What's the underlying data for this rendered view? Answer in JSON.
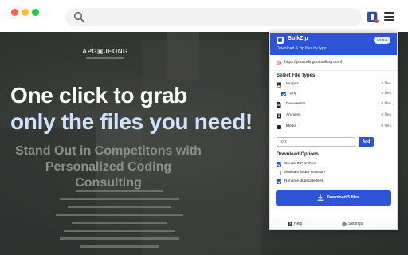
{
  "browser": {
    "url_text": ""
  },
  "site": {
    "nav": [
      "",
      "",
      "",
      "",
      ""
    ],
    "logo": "APG▣JEONG",
    "menu": [
      "",
      "",
      "",
      "",
      "",
      ""
    ],
    "overlay_line1": "One click to grab",
    "overlay_line2": "only the files you need!",
    "headline_1": "Stand Out in Competitons with",
    "headline_2": "Personalized Coding Consulting"
  },
  "popup": {
    "title": "BulkZip",
    "subtitle": "Download & zip files by type",
    "version": "v1.0.0",
    "url": "https://jejucodingconsulting.com/",
    "file_types_heading": "Select File Types",
    "file_types": [
      {
        "label": "Images",
        "count": "5 files"
      },
      {
        "label": ".png",
        "count": "5 files"
      },
      {
        "label": "Documents",
        "count": "0 files"
      },
      {
        "label": "Archives",
        "count": "0 files"
      },
      {
        "label": "Media",
        "count": "0 files"
      }
    ],
    "extension_input_placeholder": ".xyz",
    "add_button": "Add",
    "download_options_heading": "Download Options",
    "options": [
      {
        "label": "Create ZIP archive",
        "checked": true
      },
      {
        "label": "Maintain folder structure",
        "checked": false
      },
      {
        "label": "Rename duplicate files",
        "checked": true
      }
    ],
    "download_button": "Download 5 files",
    "footer": {
      "help": "Help",
      "settings": "Settings"
    }
  },
  "colors": {
    "accent": "#2b55d6",
    "overlay_line2": "#cfe3ff"
  }
}
